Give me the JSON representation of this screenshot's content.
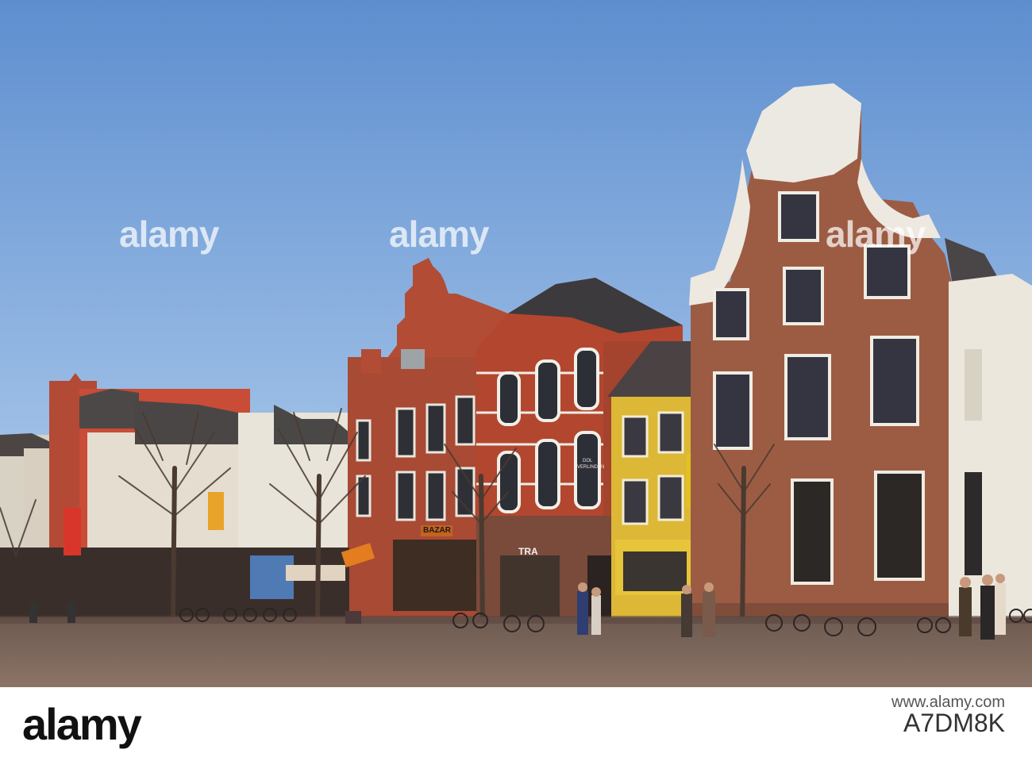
{
  "watermark": {
    "text": "alamy"
  },
  "storefronts": {
    "bazar": "BAZAR",
    "tra": "TRA",
    "verlinden_line1": "DOL",
    "verlinden_line2": "VERLINDEN"
  },
  "footer": {
    "brand": "alamy",
    "site_url": "www.alamy.com",
    "image_id": "A7DM8K"
  },
  "colors": {
    "sky_top": "#5f8fd0",
    "sky_bottom": "#9dc0e8",
    "pavement": "#8a7468",
    "brick_red": "#b2442e",
    "brick_brown": "#8d5a42",
    "white_facade": "#eae4d6",
    "yellow_facade": "#e0b832"
  }
}
